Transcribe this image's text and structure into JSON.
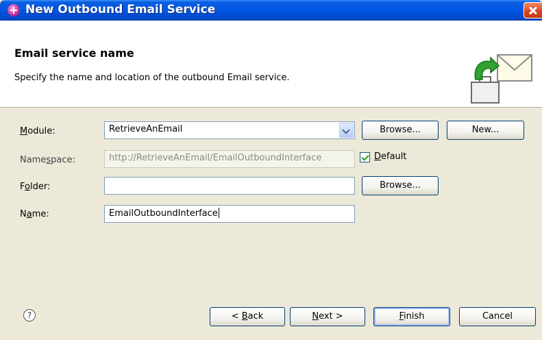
{
  "window": {
    "title": "New Outbound Email Service"
  },
  "banner": {
    "title": "Email service name",
    "description": "Specify the name and location of the outbound Email service."
  },
  "form": {
    "module": {
      "label_pre": "",
      "label_mnemonic": "M",
      "label_post": "odule:",
      "value": "RetrieveAnEmail",
      "browse_label_pre": "Browse",
      "browse_label_post": "...",
      "new_label_pre": "New",
      "new_label_post": "..."
    },
    "namespace": {
      "label_pre": "Name",
      "label_mnemonic": "s",
      "label_post": "pace:",
      "value": "http://RetrieveAnEmail/EmailOutboundInterface",
      "default_mnemonic": "D",
      "default_post": "efault",
      "default_checked": true
    },
    "folder": {
      "label_pre": "F",
      "label_mnemonic": "o",
      "label_post": "lder:",
      "value": "",
      "browse_label_pre": "Browse",
      "browse_label_post": "..."
    },
    "name": {
      "label_pre": "N",
      "label_mnemonic": "a",
      "label_post": "me:",
      "value": "EmailOutboundInterface"
    }
  },
  "footer": {
    "help_glyph": "?",
    "back": {
      "pre": "< ",
      "mnemonic": "B",
      "post": "ack"
    },
    "next": {
      "mnemonic": "N",
      "post": "ext >"
    },
    "finish": {
      "mnemonic": "F",
      "post": "inish"
    },
    "cancel": "Cancel"
  },
  "icons": {
    "title": "wizard-plus-icon",
    "close": "close-icon",
    "banner": "email-service-icon",
    "help": "help-icon",
    "combo": "chevron-down-icon",
    "check": "checkbox-checked"
  },
  "colors": {
    "titlebar": "#0055e5",
    "dialog_bg": "#ece9d8",
    "banner_bg": "#ffffff",
    "button_border": "#003c74"
  }
}
